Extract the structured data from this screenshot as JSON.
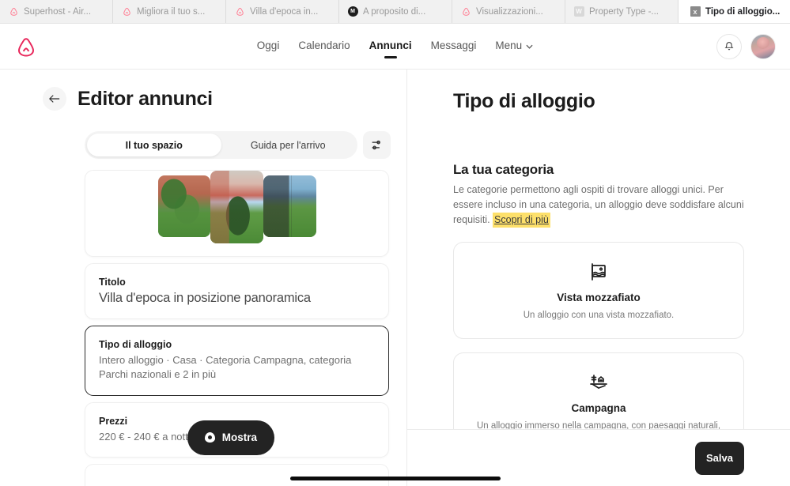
{
  "browser": {
    "tabs": [
      {
        "title": "Superhost - Air...",
        "favicon": "airbnb-icon",
        "active": false
      },
      {
        "title": "Migliora il tuo s...",
        "favicon": "airbnb-icon",
        "active": false
      },
      {
        "title": "Villa d'epoca in...",
        "favicon": "airbnb-icon",
        "active": false
      },
      {
        "title": "A proposito di...",
        "favicon": "dark-circle-icon",
        "favicon_letter": "M",
        "active": false
      },
      {
        "title": "Visualizzazioni...",
        "favicon": "airbnb-icon",
        "active": false
      },
      {
        "title": "Property Type -...",
        "favicon": "w-square-icon",
        "favicon_letter": "W",
        "active": false
      },
      {
        "title": "Tipo di alloggio...",
        "favicon": "close-box-icon",
        "favicon_letter": "x",
        "active": true
      }
    ]
  },
  "header": {
    "logo_name": "airbnb-logo",
    "nav": [
      {
        "label": "Oggi",
        "active": false
      },
      {
        "label": "Calendario",
        "active": false
      },
      {
        "label": "Annunci",
        "active": true
      },
      {
        "label": "Messaggi",
        "active": false
      }
    ],
    "menu_label": "Menu",
    "bell_name": "notifications-bell-icon",
    "avatar_name": "user-avatar"
  },
  "left": {
    "back_label": "←",
    "title": "Editor annunci",
    "tabs": [
      {
        "label": "Il tuo spazio",
        "active": true
      },
      {
        "label": "Guida per l'arrivo",
        "active": false
      }
    ],
    "filter_icon": "sliders-icon",
    "cards": {
      "photo": {
        "name": "listing-photos"
      },
      "title": {
        "label": "Titolo",
        "value": "Villa d'epoca in posizione panoramica"
      },
      "type": {
        "label": "Tipo di alloggio",
        "value": "Intero alloggio · Casa · Categoria Campagna, categoria Parchi nazionali e 2 in più",
        "selected": true
      },
      "price": {
        "label": "Prezzi",
        "value": "220 € - 240 € a notte",
        "button_label": "Mostra",
        "button_icon": "eye-icon"
      }
    }
  },
  "right": {
    "title": "Tipo di alloggio",
    "section_heading": "La tua categoria",
    "section_description": "Le categorie permettono agli ospiti di trovare alloggi unici. Per essere incluso in una categoria, un alloggio deve soddisfare alcuni requisiti.",
    "learn_more": "Scopri di più",
    "categories": [
      {
        "icon": "framed-landscape-icon",
        "name": "Vista mozzafiato",
        "description": "Un alloggio con una vista mozzafiato."
      },
      {
        "icon": "countryside-icon",
        "name": "Campagna",
        "description": "Un alloggio immerso nella campagna, con paesaggi naturali, terreni"
      }
    ],
    "save_label": "Salva"
  },
  "colors": {
    "brand": "#FF385C",
    "dark": "#232323",
    "highlight": "#FDE06B"
  }
}
